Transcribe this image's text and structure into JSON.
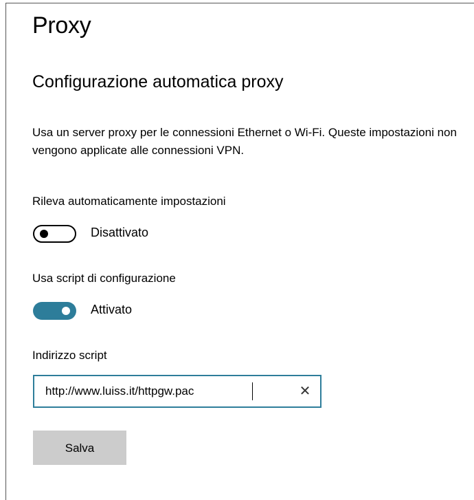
{
  "page": {
    "title": "Proxy"
  },
  "auto_proxy": {
    "section_title": "Configurazione automatica proxy",
    "description": "Usa un server proxy per le connessioni Ethernet o Wi-Fi. Queste impostazioni non vengono applicate alle connessioni VPN.",
    "detect_settings": {
      "label": "Rileva automaticamente impostazioni",
      "state": "Disattivato",
      "on": false
    },
    "use_script": {
      "label": "Usa script di configurazione",
      "state": "Attivato",
      "on": true
    },
    "script_address": {
      "label": "Indirizzo script",
      "value": "http://www.luiss.it/httpgw.pac",
      "clear_icon": "close-icon"
    },
    "save_label": "Salva"
  },
  "colors": {
    "accent": "#2d7d9a",
    "button_bg": "#cccccc",
    "text": "#000000",
    "background": "#ffffff"
  }
}
